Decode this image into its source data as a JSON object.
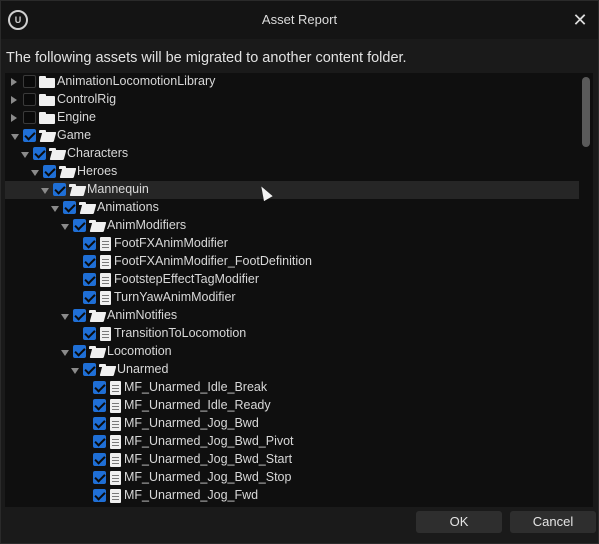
{
  "window": {
    "logo_text": "U",
    "title": "Asset Report",
    "close_glyph": "✕"
  },
  "message": "The following assets will be migrated to another content folder.",
  "tree": {
    "rows": [
      {
        "label": "AnimationLocomotionLibrary",
        "depth": 0,
        "type": "folder",
        "expander": "right",
        "checked": false
      },
      {
        "label": "ControlRig",
        "depth": 0,
        "type": "folder",
        "expander": "right",
        "checked": false
      },
      {
        "label": "Engine",
        "depth": 0,
        "type": "folder",
        "expander": "right",
        "checked": false
      },
      {
        "label": "Game",
        "depth": 0,
        "type": "folder-open",
        "expander": "down",
        "checked": true
      },
      {
        "label": "Characters",
        "depth": 1,
        "type": "folder-open",
        "expander": "down",
        "checked": true
      },
      {
        "label": "Heroes",
        "depth": 2,
        "type": "folder-open",
        "expander": "down",
        "checked": true
      },
      {
        "label": "Mannequin",
        "depth": 3,
        "type": "folder-open",
        "expander": "down",
        "checked": true,
        "highlight": true
      },
      {
        "label": "Animations",
        "depth": 4,
        "type": "folder-open",
        "expander": "down",
        "checked": true
      },
      {
        "label": "AnimModifiers",
        "depth": 5,
        "type": "folder-open",
        "expander": "down",
        "checked": true
      },
      {
        "label": "FootFXAnimModifier",
        "depth": 6,
        "type": "file",
        "expander": "none",
        "checked": true
      },
      {
        "label": "FootFXAnimModifier_FootDefinition",
        "depth": 6,
        "type": "file",
        "expander": "none",
        "checked": true
      },
      {
        "label": "FootstepEffectTagModifier",
        "depth": 6,
        "type": "file",
        "expander": "none",
        "checked": true
      },
      {
        "label": "TurnYawAnimModifier",
        "depth": 6,
        "type": "file",
        "expander": "none",
        "checked": true
      },
      {
        "label": "AnimNotifies",
        "depth": 5,
        "type": "folder-open",
        "expander": "down",
        "checked": true
      },
      {
        "label": "TransitionToLocomotion",
        "depth": 6,
        "type": "file",
        "expander": "none",
        "checked": true
      },
      {
        "label": "Locomotion",
        "depth": 5,
        "type": "folder-open",
        "expander": "down",
        "checked": true
      },
      {
        "label": "Unarmed",
        "depth": 6,
        "type": "folder-open",
        "expander": "down",
        "checked": true
      },
      {
        "label": "MF_Unarmed_Idle_Break",
        "depth": 7,
        "type": "file",
        "expander": "none",
        "checked": true
      },
      {
        "label": "MF_Unarmed_Idle_Ready",
        "depth": 7,
        "type": "file",
        "expander": "none",
        "checked": true
      },
      {
        "label": "MF_Unarmed_Jog_Bwd",
        "depth": 7,
        "type": "file",
        "expander": "none",
        "checked": true
      },
      {
        "label": "MF_Unarmed_Jog_Bwd_Pivot",
        "depth": 7,
        "type": "file",
        "expander": "none",
        "checked": true
      },
      {
        "label": "MF_Unarmed_Jog_Bwd_Start",
        "depth": 7,
        "type": "file",
        "expander": "none",
        "checked": true
      },
      {
        "label": "MF_Unarmed_Jog_Bwd_Stop",
        "depth": 7,
        "type": "file",
        "expander": "none",
        "checked": true
      },
      {
        "label": "MF_Unarmed_Jog_Fwd",
        "depth": 7,
        "type": "file",
        "expander": "none",
        "checked": true
      }
    ]
  },
  "buttons": {
    "ok": "OK",
    "cancel": "Cancel"
  },
  "colors": {
    "accent": "#1f6fd6",
    "background": "#1a1a1a",
    "tree_background": "#0f0f0f"
  }
}
